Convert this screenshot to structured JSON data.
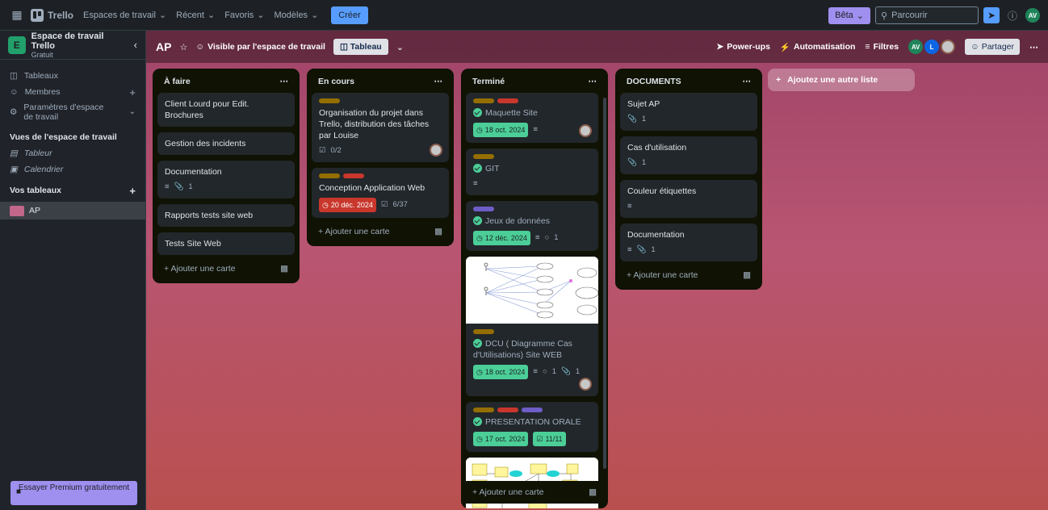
{
  "topbar": {
    "logo": "Trello",
    "nav": [
      "Espaces de travail",
      "Récent",
      "Favoris",
      "Modèles"
    ],
    "create": "Créer",
    "beta": "Bêta",
    "search_placeholder": "Parcourir",
    "user_initials": "AV"
  },
  "sidebar": {
    "workspace_initial": "E",
    "workspace_name": "Espace de travail Trello",
    "workspace_plan": "Gratuit",
    "items": [
      "Tableaux",
      "Membres",
      "Paramètres d'espace de travail"
    ],
    "views_heading": "Vues de l'espace de travail",
    "views": [
      "Tableur",
      "Calendrier"
    ],
    "boards_heading": "Vos tableaux",
    "boards": [
      "AP"
    ],
    "premium": "Essayer Premium gratuitement"
  },
  "board": {
    "title": "AP",
    "visibility": "Visible par l'espace de travail",
    "view": "Tableau",
    "powerups": "Power-ups",
    "automation": "Automatisation",
    "filters": "Filtres",
    "members": [
      "AV",
      "L"
    ],
    "share": "Partager",
    "add_list": "Ajoutez une autre liste",
    "add_card": "Ajouter une carte",
    "lists": [
      {
        "title": "À faire",
        "cards": [
          {
            "title": "Client Lourd pour Edit. Brochures"
          },
          {
            "title": "Gestion des incidents"
          },
          {
            "title": "Documentation",
            "attachments": "1"
          },
          {
            "title": "Rapports tests site web"
          },
          {
            "title": "Tests Site Web"
          }
        ]
      },
      {
        "title": "En cours",
        "cards": [
          {
            "title": "Organisation du projet dans Trello, distribution des tâches par Louise",
            "checklist": "0/2"
          },
          {
            "title": "Conception Application Web",
            "due": "20 déc. 2024",
            "checklist": "6/37"
          }
        ]
      },
      {
        "title": "Terminé",
        "cards": [
          {
            "title": "Maquette Site",
            "due": "18 oct. 2024"
          },
          {
            "title": "GIT"
          },
          {
            "title": "Jeux de données",
            "due": "12 déc. 2024",
            "comments": "1"
          },
          {
            "title": "DCU ( Diagramme Cas d'Utilisations) Site WEB",
            "due": "18 oct. 2024",
            "comments": "1",
            "attachments": "1"
          },
          {
            "title": "PRESENTATION ORALE",
            "due": "17 oct. 2024",
            "checklist": "11/11"
          }
        ]
      },
      {
        "title": "DOCUMENTS",
        "cards": [
          {
            "title": "Sujet AP",
            "attachments": "1"
          },
          {
            "title": "Cas d'utilisation",
            "attachments": "1"
          },
          {
            "title": "Couleur étiquettes"
          },
          {
            "title": "Documentation",
            "attachments": "1"
          }
        ]
      }
    ]
  }
}
